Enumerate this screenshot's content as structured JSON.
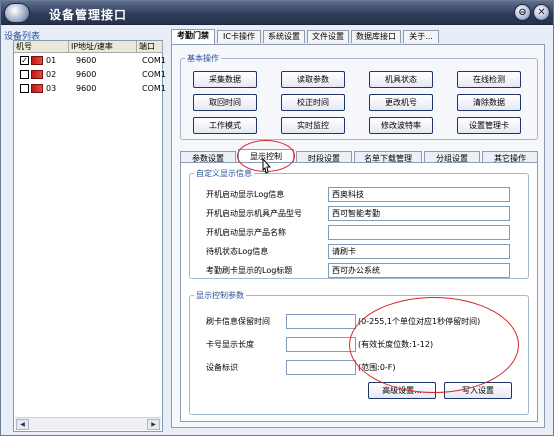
{
  "window": {
    "title": "设备管理接口"
  },
  "device_list": {
    "label": "设备列表",
    "columns": [
      "机号",
      "IP地址/速率",
      "端口"
    ],
    "rows": [
      {
        "checked": true,
        "id": "01",
        "rate": "9600",
        "port": "COM1"
      },
      {
        "checked": false,
        "id": "02",
        "rate": "9600",
        "port": "COM1"
      },
      {
        "checked": false,
        "id": "03",
        "rate": "9600",
        "port": "COM1"
      }
    ]
  },
  "top_tabs": [
    "考勤门禁",
    "IC卡操作",
    "系统设置",
    "文件设置",
    "数据库接口",
    "关于..."
  ],
  "basic_ops": {
    "title": "基本操作",
    "buttons": [
      "采集数据",
      "读取参数",
      "机具状态",
      "在线检测",
      "取回时间",
      "校正时间",
      "更改机号",
      "清除数据",
      "工作模式",
      "实时监控",
      "修改波特率",
      "设置管理卡"
    ]
  },
  "sub_tabs": [
    "参数设置",
    "显示控制",
    "时段设置",
    "名单下载管理",
    "分组设置",
    "其它操作"
  ],
  "custom_display": {
    "title": "自定义显示信息",
    "fields": [
      {
        "label": "开机启动显示Log信息",
        "value": "西奥科技"
      },
      {
        "label": "开机启动显示机具产品型号",
        "value": "西可智能考勤"
      },
      {
        "label": "开机启动显示产品名称",
        "value": ""
      },
      {
        "label": "待机状态Log信息",
        "value": "请刷卡"
      },
      {
        "label": "考勤刷卡显示的Log标题",
        "value": "西可办公系统"
      }
    ]
  },
  "display_params": {
    "title": "显示控制参数",
    "fields": [
      {
        "label": "刷卡信息保留时间",
        "value": "",
        "note": "(0-255,1个单位对应1秒停留时间)"
      },
      {
        "label": "卡号显示长度",
        "value": "",
        "note": "(有效长度位数:1-12)"
      },
      {
        "label": "设备标识",
        "value": "",
        "note": "(范围:0-F)"
      }
    ],
    "buttons": {
      "advanced": "高级设置...",
      "write": "写入设置"
    }
  },
  "icons": {
    "minimize": "⊖",
    "close": "✕"
  },
  "colors": {
    "title_bar": "#2f3d5a",
    "group_title": "#2a4f9c",
    "annotation": "#d8262a"
  }
}
